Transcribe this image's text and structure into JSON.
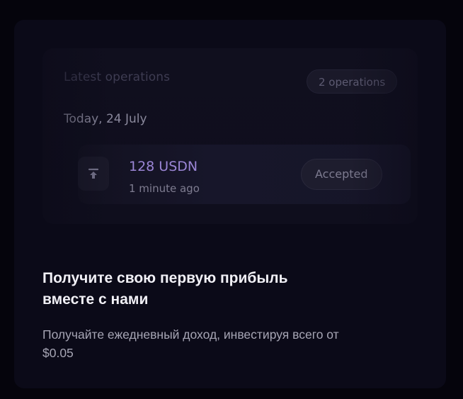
{
  "operations_preview": {
    "title": "Latest operations",
    "count_badge": "2 operations",
    "date_group": "Today, 24 July",
    "items": [
      {
        "icon": "upload-icon",
        "amount": "128 USDN",
        "time": "1 minute ago",
        "status": "Accepted"
      }
    ]
  },
  "promo": {
    "title": "Получите свою первую прибыль вместе с нами",
    "description": "Получайте ежедневный доход, инвестируя всего от $0.05"
  },
  "colors": {
    "background": "#05040c",
    "card": "#0b0a18",
    "accent_amount": "#9b86d6",
    "title_text": "#f1f0f6",
    "secondary_text": "#a6a5b4"
  }
}
